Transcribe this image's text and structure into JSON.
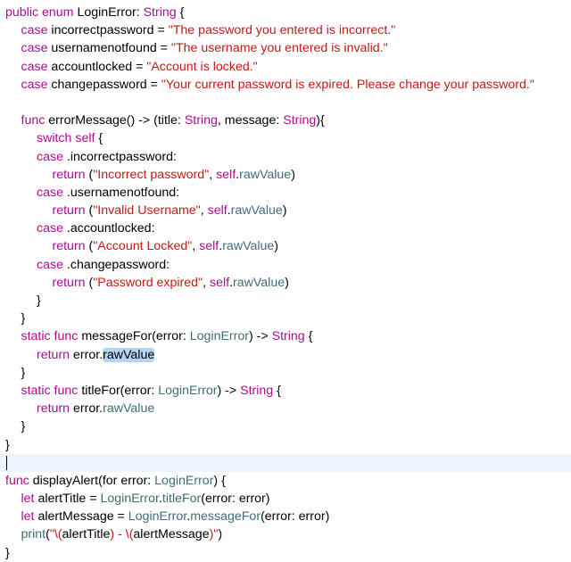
{
  "editor": {
    "language": "swift",
    "theme_colors": {
      "keyword": "#aa0d91",
      "type": "#3f6e74",
      "string": "#c41a16",
      "plain": "#000000",
      "selection": "#b5d3f3",
      "current_line": "#ecf5ff"
    },
    "lines": [
      {
        "indent": 0,
        "tokens": [
          [
            "kw",
            "public enum "
          ],
          [
            "pl",
            "LoginError: "
          ],
          [
            "kw",
            "String"
          ],
          [
            "pl",
            " {"
          ]
        ]
      },
      {
        "indent": 1,
        "tokens": [
          [
            "kw",
            "case "
          ],
          [
            "pl",
            "incorrectpassword = "
          ],
          [
            "str",
            "\"The password you entered is incorrect.\""
          ]
        ]
      },
      {
        "indent": 1,
        "tokens": [
          [
            "kw",
            "case "
          ],
          [
            "pl",
            "usernamenotfound = "
          ],
          [
            "str",
            "\"The username you entered is invalid.\""
          ]
        ]
      },
      {
        "indent": 1,
        "tokens": [
          [
            "kw",
            "case "
          ],
          [
            "pl",
            "accountlocked = "
          ],
          [
            "str",
            "\"Account is locked.\""
          ]
        ]
      },
      {
        "indent": 1,
        "tokens": [
          [
            "kw",
            "case "
          ],
          [
            "pl",
            "changepassword = "
          ],
          [
            "str",
            "\"Your current password is expired. Please change your password.\""
          ]
        ]
      },
      {
        "indent": 0,
        "tokens": []
      },
      {
        "indent": 1,
        "tokens": [
          [
            "kw",
            "func "
          ],
          [
            "pl",
            "errorMessage() -> (title: "
          ],
          [
            "kw",
            "String"
          ],
          [
            "pl",
            ", message: "
          ],
          [
            "kw",
            "String"
          ],
          [
            "pl",
            ")"
          ],
          [
            "pl",
            "{"
          ]
        ]
      },
      {
        "indent": 2,
        "tokens": [
          [
            "kw",
            "switch self"
          ],
          [
            "pl",
            " {"
          ]
        ]
      },
      {
        "indent": 2,
        "tokens": [
          [
            "kw",
            "case "
          ],
          [
            "pl",
            ".incorrectpassword:"
          ]
        ]
      },
      {
        "indent": 3,
        "tokens": [
          [
            "kw",
            "return "
          ],
          [
            "pl",
            "("
          ],
          [
            "str",
            "\"Incorrect password\""
          ],
          [
            "pl",
            ", "
          ],
          [
            "kw",
            "self"
          ],
          [
            "pl",
            "."
          ],
          [
            "ty",
            "rawValue"
          ],
          [
            "pl",
            ")"
          ]
        ]
      },
      {
        "indent": 2,
        "tokens": [
          [
            "kw",
            "case "
          ],
          [
            "pl",
            ".usernamenotfound:"
          ]
        ]
      },
      {
        "indent": 3,
        "tokens": [
          [
            "kw",
            "return "
          ],
          [
            "pl",
            "("
          ],
          [
            "str",
            "\"Invalid Username\""
          ],
          [
            "pl",
            ", "
          ],
          [
            "kw",
            "self"
          ],
          [
            "pl",
            "."
          ],
          [
            "ty",
            "rawValue"
          ],
          [
            "pl",
            ")"
          ]
        ]
      },
      {
        "indent": 2,
        "tokens": [
          [
            "kw",
            "case "
          ],
          [
            "pl",
            ".accountlocked:"
          ]
        ]
      },
      {
        "indent": 3,
        "tokens": [
          [
            "kw",
            "return "
          ],
          [
            "pl",
            "("
          ],
          [
            "str",
            "\"Account Locked\""
          ],
          [
            "pl",
            ", "
          ],
          [
            "kw",
            "self"
          ],
          [
            "pl",
            "."
          ],
          [
            "ty",
            "rawValue"
          ],
          [
            "pl",
            ")"
          ]
        ]
      },
      {
        "indent": 2,
        "tokens": [
          [
            "kw",
            "case "
          ],
          [
            "pl",
            ".changepassword:"
          ]
        ]
      },
      {
        "indent": 3,
        "tokens": [
          [
            "kw",
            "return "
          ],
          [
            "pl",
            "("
          ],
          [
            "str",
            "\"Password expired\""
          ],
          [
            "pl",
            ", "
          ],
          [
            "kw",
            "self"
          ],
          [
            "pl",
            "."
          ],
          [
            "ty",
            "rawValue"
          ],
          [
            "pl",
            ")"
          ]
        ]
      },
      {
        "indent": 2,
        "tokens": [
          [
            "pl",
            "}"
          ]
        ]
      },
      {
        "indent": 1,
        "tokens": [
          [
            "pl",
            "}"
          ]
        ]
      },
      {
        "indent": 1,
        "tokens": [
          [
            "kw",
            "static func "
          ],
          [
            "pl",
            "messageFor(error: "
          ],
          [
            "ty",
            "LoginError"
          ],
          [
            "pl",
            ") -> "
          ],
          [
            "kw",
            "String"
          ],
          [
            "pl",
            " {"
          ]
        ]
      },
      {
        "indent": 2,
        "tokens": [
          [
            "kw",
            "return "
          ],
          [
            "pl",
            "error."
          ],
          [
            "sel",
            "rawValue"
          ]
        ]
      },
      {
        "indent": 1,
        "tokens": [
          [
            "pl",
            "}"
          ]
        ]
      },
      {
        "indent": 1,
        "tokens": [
          [
            "kw",
            "static func "
          ],
          [
            "pl",
            "titleFor(error: "
          ],
          [
            "ty",
            "LoginError"
          ],
          [
            "pl",
            ") -> "
          ],
          [
            "kw",
            "String"
          ],
          [
            "pl",
            " {"
          ]
        ]
      },
      {
        "indent": 2,
        "tokens": [
          [
            "kw",
            "return "
          ],
          [
            "pl",
            "error."
          ],
          [
            "ty",
            "rawValue"
          ]
        ]
      },
      {
        "indent": 1,
        "tokens": [
          [
            "pl",
            "}"
          ]
        ]
      },
      {
        "indent": 0,
        "tokens": [
          [
            "pl",
            "}"
          ]
        ]
      },
      {
        "indent": 0,
        "tokens": [],
        "caret": true,
        "current": true
      },
      {
        "indent": 0,
        "tokens": [
          [
            "kw",
            "func "
          ],
          [
            "pl",
            "displayAlert(for error: "
          ],
          [
            "ty",
            "LoginError"
          ],
          [
            "pl",
            ") {"
          ]
        ]
      },
      {
        "indent": 1,
        "tokens": [
          [
            "kw",
            "let "
          ],
          [
            "pl",
            "alertTitle = "
          ],
          [
            "ty",
            "LoginError"
          ],
          [
            "pl",
            "."
          ],
          [
            "ty",
            "titleFor"
          ],
          [
            "pl",
            "(error: error)"
          ]
        ]
      },
      {
        "indent": 1,
        "tokens": [
          [
            "kw",
            "let "
          ],
          [
            "pl",
            "alertMessage = "
          ],
          [
            "ty",
            "LoginError"
          ],
          [
            "pl",
            "."
          ],
          [
            "ty",
            "messageFor"
          ],
          [
            "pl",
            "(error: error)"
          ]
        ]
      },
      {
        "indent": 1,
        "tokens": [
          [
            "ty",
            "print"
          ],
          [
            "pl",
            "("
          ],
          [
            "str",
            "\"\\("
          ],
          [
            "pl",
            "alertTitle"
          ],
          [
            "str",
            ") - \\("
          ],
          [
            "pl",
            "alertMessage"
          ],
          [
            "str",
            ")\""
          ],
          [
            "pl",
            ")"
          ]
        ]
      },
      {
        "indent": 0,
        "tokens": [
          [
            "pl",
            "}"
          ]
        ]
      }
    ]
  }
}
